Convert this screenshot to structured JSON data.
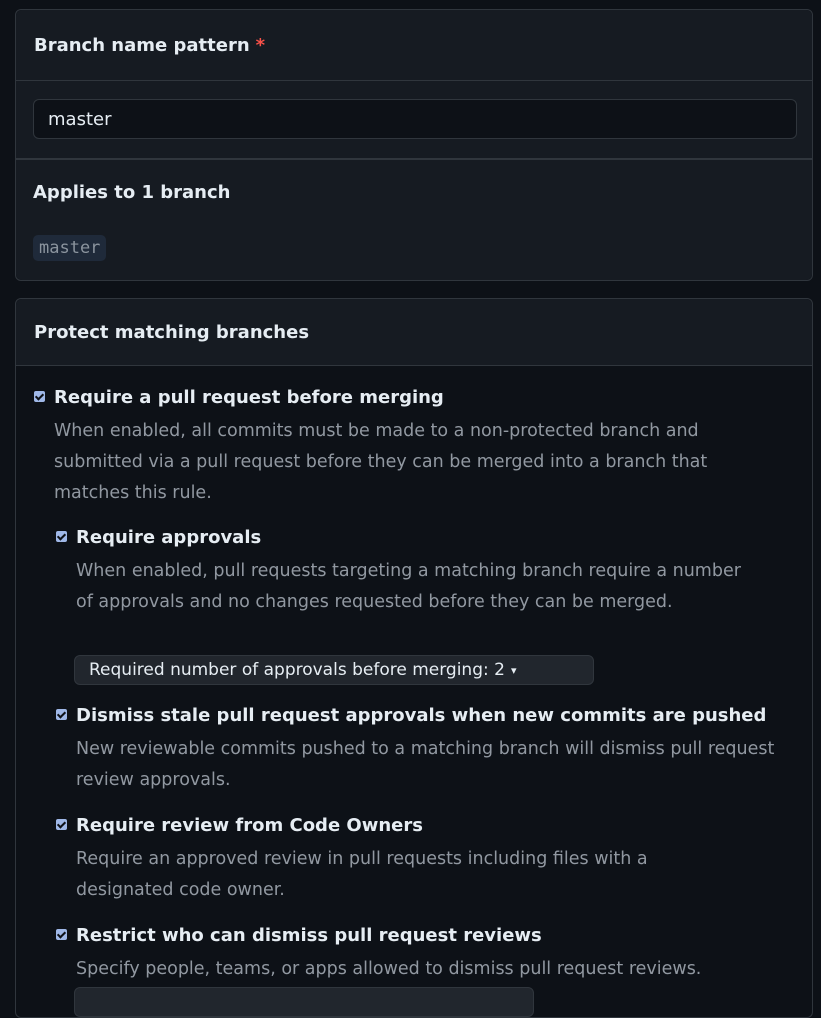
{
  "pattern_section": {
    "title": "Branch name pattern",
    "required_mark": "*",
    "input_value": "master"
  },
  "applies_section": {
    "title": "Applies to 1 branch",
    "branches": [
      "master"
    ]
  },
  "protect_section": {
    "title": "Protect matching branches",
    "options": [
      {
        "title": "Require a pull request before merging",
        "description": "When enabled, all commits must be made to a non-protected branch and submitted via a pull request before they can be merged into a branch that matches this rule.",
        "checked": true
      },
      {
        "title": "Require approvals",
        "description": "When enabled, pull requests targeting a matching branch require a number of approvals and no changes requested before they can be merged.",
        "checked": true
      },
      {
        "title": "Dismiss stale pull request approvals when new commits are pushed",
        "description": "New reviewable commits pushed to a matching branch will dismiss pull request review approvals.",
        "checked": true
      },
      {
        "title": "Require review from Code Owners",
        "description": "Require an approved review in pull requests including files with a designated code owner.",
        "checked": true
      },
      {
        "title": "Restrict who can dismiss pull request reviews",
        "description": "Specify people, teams, or apps allowed to dismiss pull request reviews.",
        "checked": true
      }
    ],
    "approvals_dropdown": {
      "label": "Required number of approvals before merging: 2"
    }
  },
  "colors": {
    "background": "#0d1117",
    "panel": "#161b22",
    "border": "#30363d",
    "required": "#f85149",
    "checkbox": "#9fb8e8",
    "muted_text": "#9198a1"
  }
}
